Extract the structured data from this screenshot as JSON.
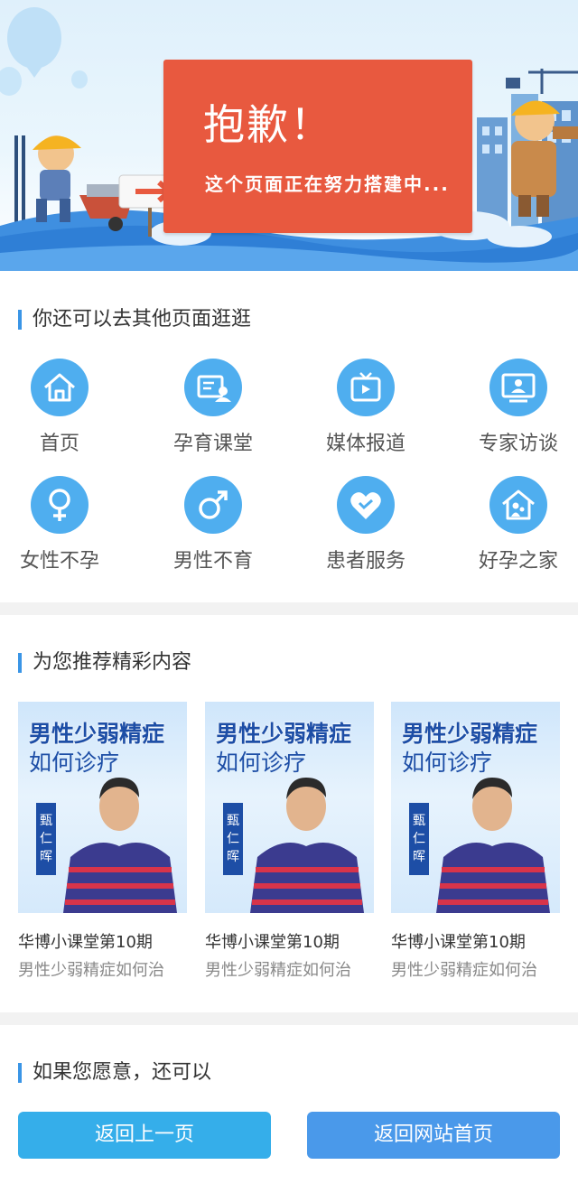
{
  "banner": {
    "title": "抱歉！",
    "subtitle": "这个页面正在努力搭建中..."
  },
  "nav_section": {
    "title": "你还可以去其他页面逛逛",
    "items": [
      {
        "label": "首页",
        "icon": "home-icon"
      },
      {
        "label": "孕育课堂",
        "icon": "classroom-icon"
      },
      {
        "label": "媒体报道",
        "icon": "tv-icon"
      },
      {
        "label": "专家访谈",
        "icon": "monitor-user-icon"
      },
      {
        "label": "女性不孕",
        "icon": "female-icon"
      },
      {
        "label": "男性不育",
        "icon": "male-icon"
      },
      {
        "label": "患者服务",
        "icon": "heart-icon"
      },
      {
        "label": "好孕之家",
        "icon": "family-home-icon"
      }
    ]
  },
  "recommend_section": {
    "title": "为您推荐精彩内容",
    "cards": [
      {
        "thumb_title_1": "男性少弱精症",
        "thumb_title_2": "如何诊疗",
        "doctor_name": "甄仁晖",
        "line1": "华博小课堂第10期",
        "line2": "男性少弱精症如何治"
      },
      {
        "thumb_title_1": "男性少弱精症",
        "thumb_title_2": "如何诊疗",
        "doctor_name": "甄仁晖",
        "line1": "华博小课堂第10期",
        "line2": "男性少弱精症如何治"
      },
      {
        "thumb_title_1": "男性少弱精症",
        "thumb_title_2": "如何诊疗",
        "doctor_name": "甄仁晖",
        "line1": "华博小课堂第10期",
        "line2": "男性少弱精症如何治"
      }
    ]
  },
  "action_section": {
    "title": "如果您愿意，还可以",
    "back_label": "返回上一页",
    "home_label": "返回网站首页"
  },
  "colors": {
    "accent": "#4faeef",
    "sign": "#e8593f",
    "button_back": "#35aeea",
    "button_home": "#4a99ea"
  }
}
